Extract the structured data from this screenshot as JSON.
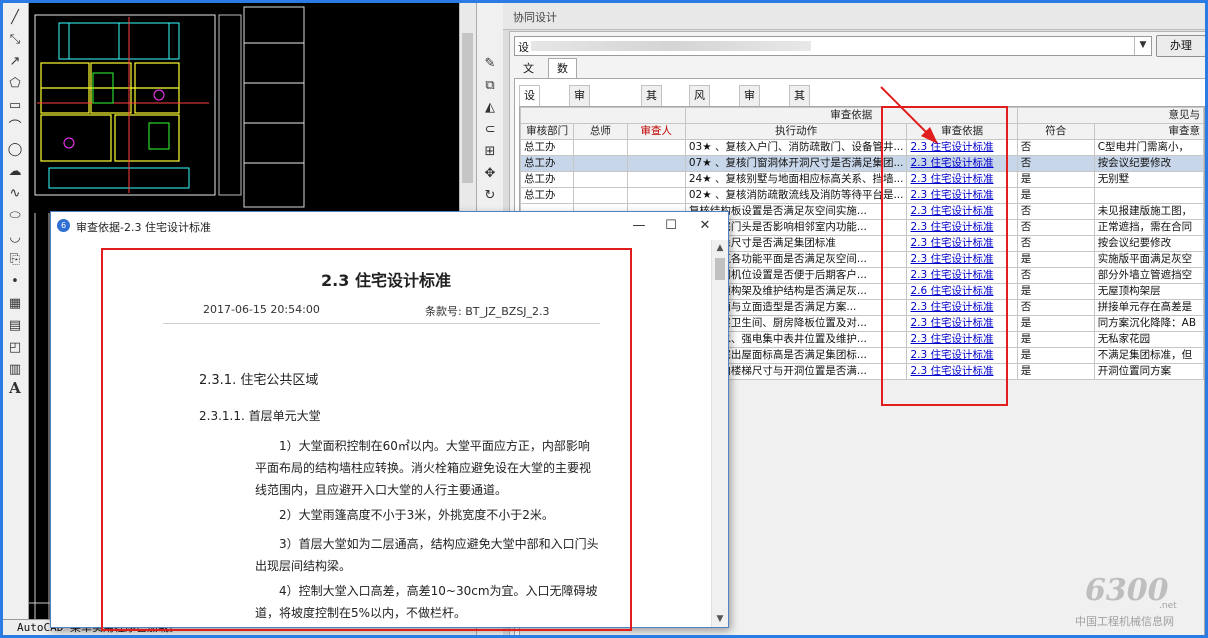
{
  "cad": {
    "status_text": "AutoCAD 菜单实用程序已加载。"
  },
  "collab": {
    "title": "协同设计",
    "project_value": "设",
    "handle_button": "办理",
    "tabs": [
      "文件",
      "数据"
    ],
    "sub_tabs": [
      "设计审查",
      "审查意见汇总",
      "其他审查",
      "风险清单",
      "审查附件",
      "其他附件"
    ],
    "group_headers": {
      "basis": "审查依据",
      "opinion": "意见与"
    },
    "columns": [
      "审核部门",
      "总师",
      "审查人",
      "执行动作",
      "审查依据",
      "符合",
      "审查意"
    ],
    "rows": [
      {
        "dept": "总工办",
        "action": "03★ 、复核入户门、消防疏散门、设备管井...",
        "basis": "2.3 住宅设计标准",
        "match": "否",
        "opinion": "C型电井门需离小，"
      },
      {
        "dept": "总工办",
        "action": "07★ 、复核门窗洞体开洞尺寸是否满足集团...",
        "basis": "2.3 住宅设计标准",
        "match": "否",
        "opinion": "按会议纪要修改"
      },
      {
        "dept": "总工办",
        "action": "24★ 、复核别墅与地面相应标高关系、挡墙...",
        "basis": "2.3 住宅设计标准",
        "match": "是",
        "opinion": "无别墅"
      },
      {
        "dept": "总工办",
        "action": "02★ 、复核消防疏散流线及消防等待平台是...",
        "basis": "2.3 住宅设计标准",
        "match": "是",
        "opinion": ""
      },
      {
        "dept": "",
        "action": "复核结构板设置是否满足灰空间实施...",
        "basis": "2.3 住宅设计标准",
        "match": "否",
        "opinion": "未见报建版施工图，"
      },
      {
        "dept": "",
        "action": "复核住宅门头是否影响相邻室内功能...",
        "basis": "2.3 住宅设计标准",
        "match": "否",
        "opinion": "正常遮挡，需在合同"
      },
      {
        "dept": "",
        "action": "复核门垛尺寸是否满足集团标准",
        "basis": "2.3 住宅设计标准",
        "match": "否",
        "opinion": "按会议纪要修改"
      },
      {
        "dept": "",
        "action": "复核建筑各功能平面是否满足灰空间...",
        "basis": "2.3 住宅设计标准",
        "match": "是",
        "opinion": "实施版平面满足灰空"
      },
      {
        "dept": "",
        "action": "复核空调机位设置是否便于后期客户...",
        "basis": "2.3 住宅设计标准",
        "match": "否",
        "opinion": "部分外墙立管遮挡空"
      },
      {
        "dept": "",
        "action": "复核屋顶构架及维护结构是否满足灰...",
        "basis": "2.6 住宅设计标准",
        "match": "是",
        "opinion": "无屋顶构架层"
      },
      {
        "dept": "",
        "action": "复核平面与立面造型是否满足方案...",
        "basis": "2.3 住宅设计标准",
        "match": "否",
        "opinion": "拼接单元存在高差是"
      },
      {
        "dept": "",
        "action": "复核跃层卫生间、厨房降板位置及对...",
        "basis": "2.3 住宅设计标准",
        "match": "是",
        "opinion": "同方案沉化降降：AB"
      },
      {
        "dept": "",
        "action": "复核给水、强电集中表井位置及维护...",
        "basis": "2.3 住宅设计标准",
        "match": "是",
        "opinion": "无私家花园"
      },
      {
        "dept": "",
        "action": "复核住宅出屋面标高是否满足集团标...",
        "basis": "2.3 住宅设计标准",
        "match": "是",
        "opinion": "不满足集团标准，但"
      },
      {
        "dept": "",
        "action": "复核室内楼梯尺寸与开洞位置是否满...",
        "basis": "2.3 住宅设计标准",
        "match": "是",
        "opinion": "开洞位置同方案"
      }
    ]
  },
  "popup": {
    "title": "审查依据-2.3 住宅设计标准",
    "doc_title": "2.3 住宅设计标准",
    "date": "2017-06-15 20:54:00",
    "code": "条款号: BT_JZ_BZSJ_2.3",
    "h1": "2.3.1.  住宅公共区域",
    "h2": "2.3.1.1. 首层单元大堂",
    "paras": [
      "1）大堂面积控制在60㎡以内。大堂平面应方正，内部影响平面布局的结构墙柱应转换。消火栓箱应避免设在大堂的主要视线范围内，且应避开入口大堂的人行主要通道。",
      "2）大堂雨篷高度不小于3米，外挑宽度不小于2米。",
      "3）首层大堂如为二层通高，结构应避免大堂中部和入口门头出现层间结构梁。",
      "4）控制大堂入口高差，高差10~30cm为宜。入口无障碍坡道，将坡度控制在5%以内，不做栏杆。"
    ]
  },
  "watermark": {
    "big": "6300",
    "net": ".net",
    "cn": "中国工程机械信息网"
  },
  "colors": {
    "accent_red": "#e11d1d",
    "link_blue": "#0000cc",
    "selected_row": "#c8d6ea",
    "window_border": "#2a7be4"
  }
}
